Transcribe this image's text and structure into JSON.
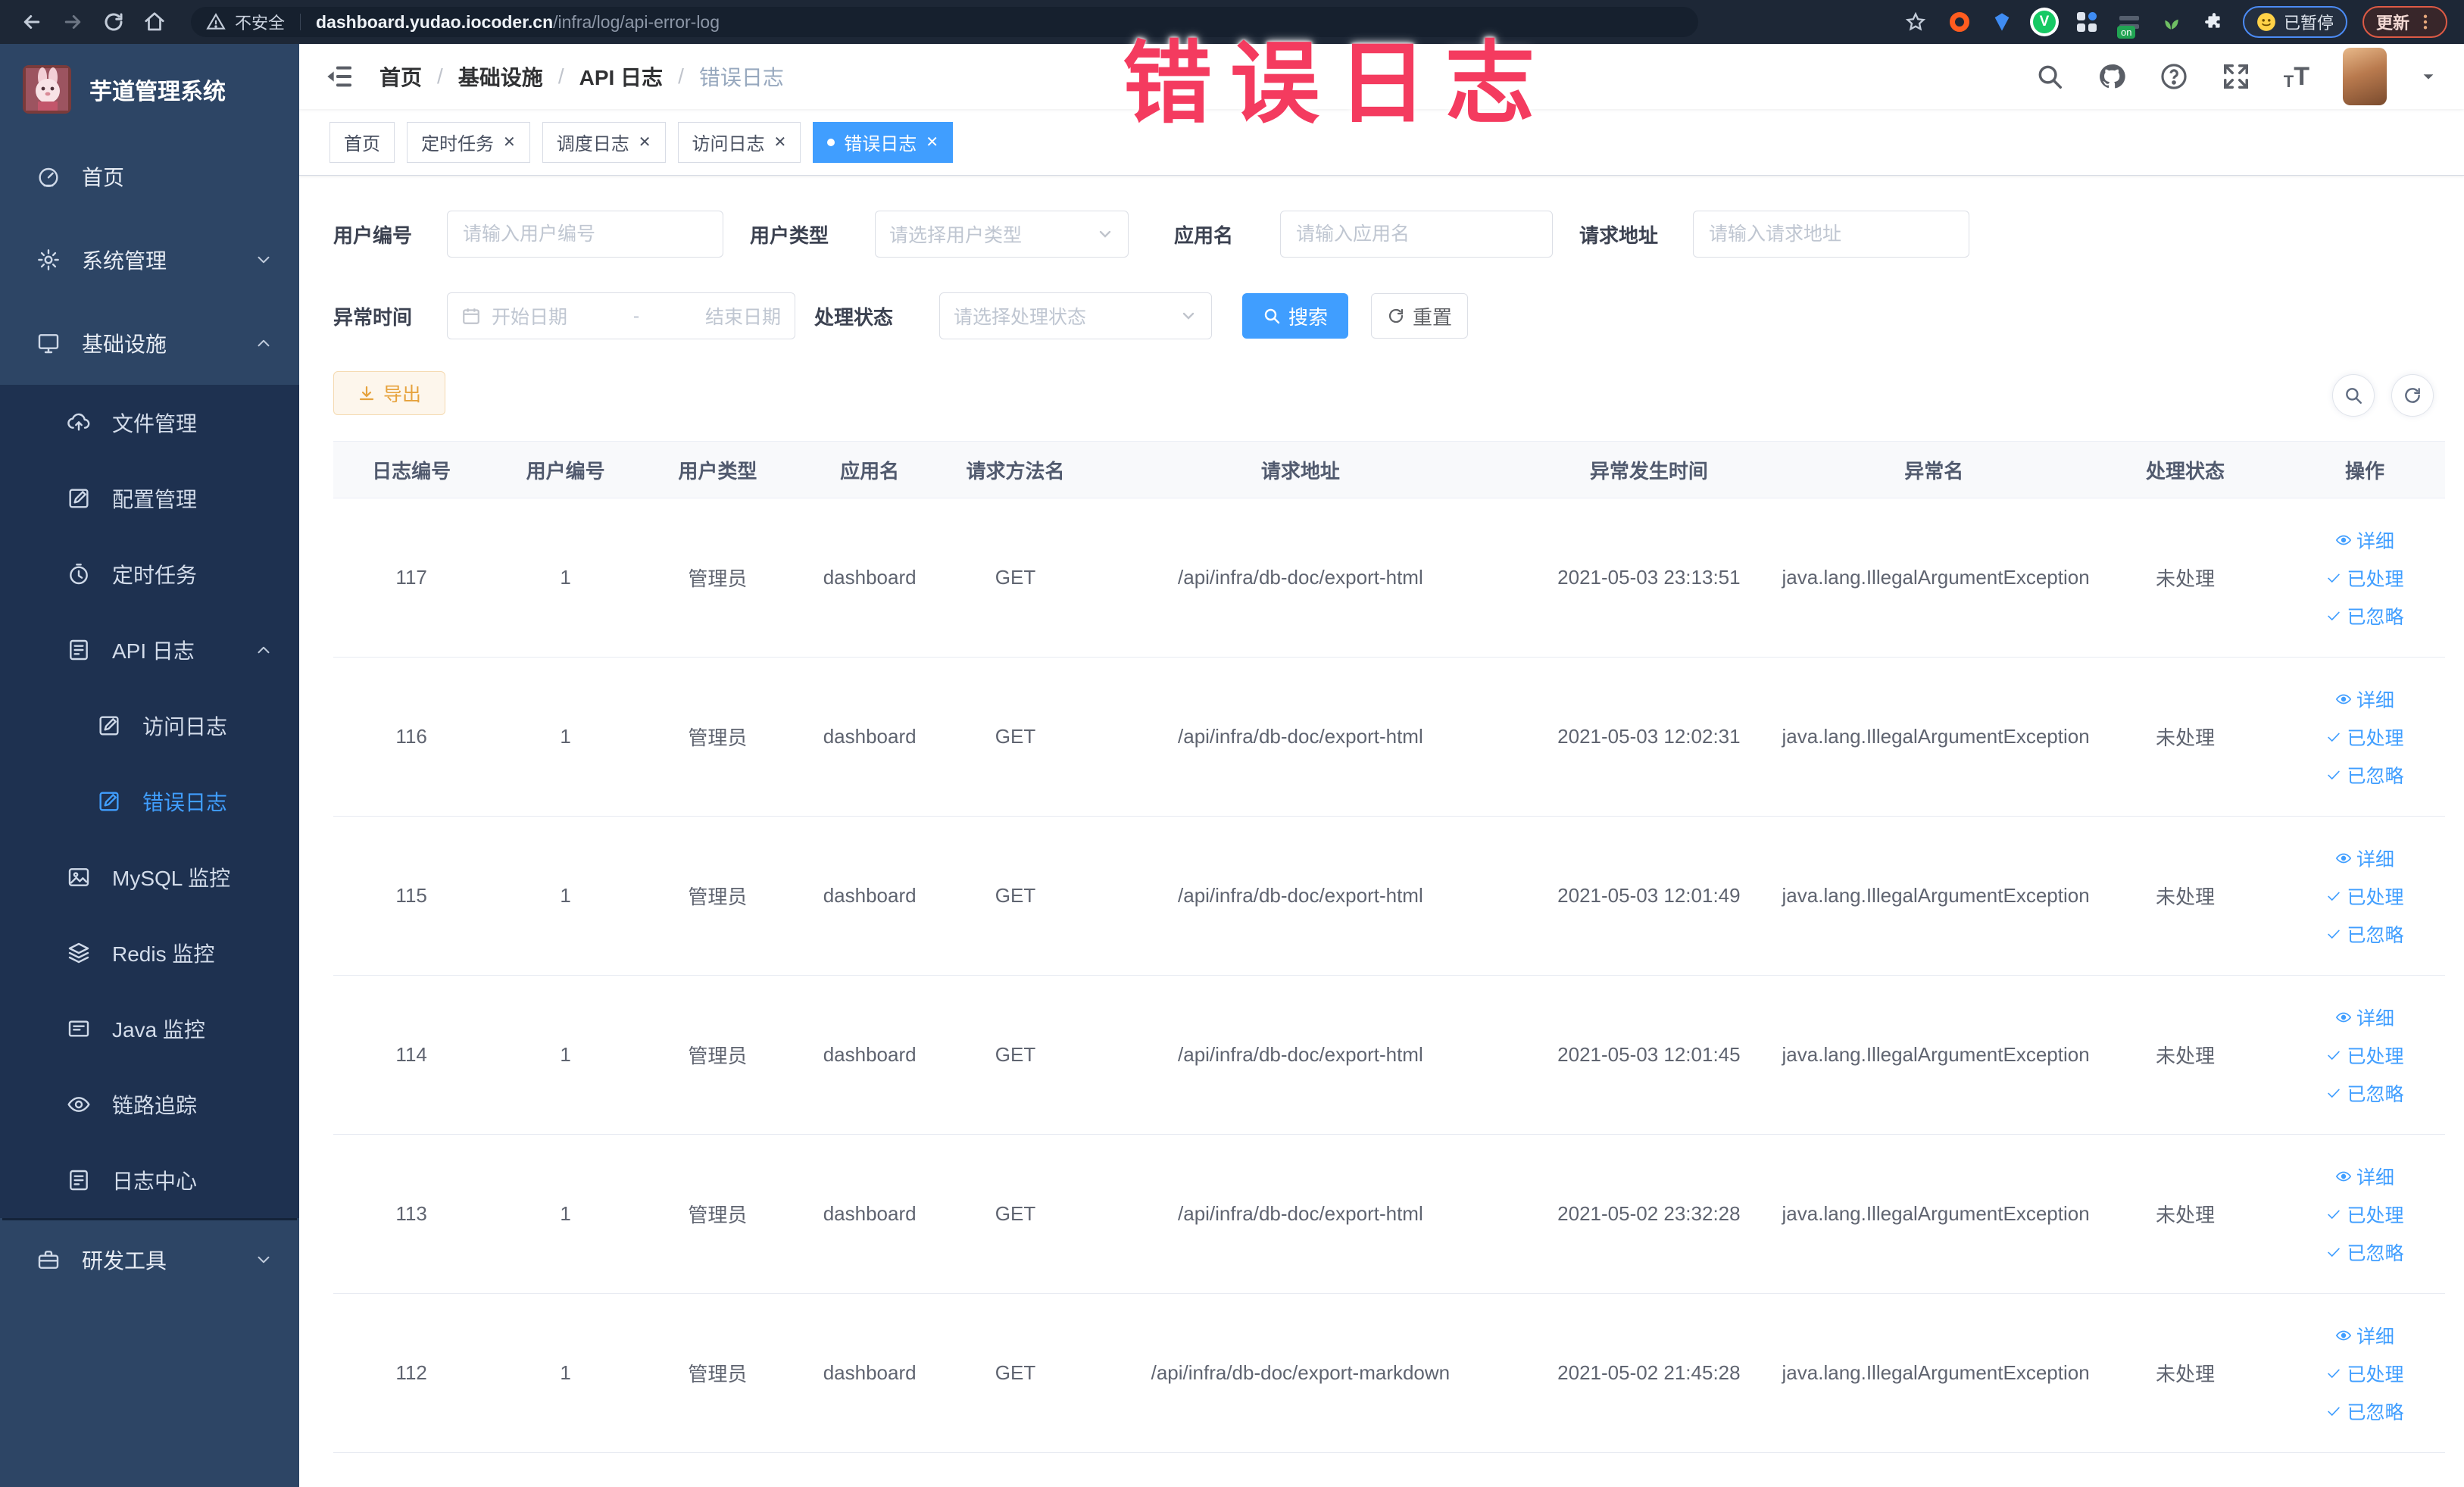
{
  "browser": {
    "security_label": "不安全",
    "url_domain": "dashboard.yudao.iocoder.cn",
    "url_path": "/infra/log/api-error-log",
    "paused_badge": "已暂停",
    "update_badge": "更新",
    "extension_on_badge": "on"
  },
  "overlay": {
    "title": "错误日志"
  },
  "sidebar": {
    "app_title": "芋道管理系统",
    "menu": [
      {
        "label": "首页",
        "icon": "gauge",
        "level": 0
      },
      {
        "label": "系统管理",
        "icon": "gear",
        "level": 0,
        "arrow": "down"
      },
      {
        "label": "基础设施",
        "icon": "monitor",
        "level": 0,
        "arrow": "up"
      },
      {
        "label": "文件管理",
        "icon": "upload",
        "level": 1
      },
      {
        "label": "配置管理",
        "icon": "edit",
        "level": 1
      },
      {
        "label": "定时任务",
        "icon": "timer",
        "level": 1
      },
      {
        "label": "API 日志",
        "icon": "log",
        "level": 1,
        "arrow": "up"
      },
      {
        "label": "访问日志",
        "icon": "edit",
        "level": 2
      },
      {
        "label": "错误日志",
        "icon": "edit",
        "level": 2,
        "active": true
      },
      {
        "label": "MySQL 监控",
        "icon": "chart",
        "level": 1
      },
      {
        "label": "Redis 监控",
        "icon": "layers",
        "level": 1
      },
      {
        "label": "Java 监控",
        "icon": "screen",
        "level": 1
      },
      {
        "label": "链路追踪",
        "icon": "eye",
        "level": 1
      },
      {
        "label": "日志中心",
        "icon": "log",
        "level": 1,
        "sublast": true
      },
      {
        "label": "研发工具",
        "icon": "toolbox",
        "level": 0,
        "arrow": "down"
      }
    ]
  },
  "breadcrumb": [
    "首页",
    "基础设施",
    "API 日志",
    "错误日志"
  ],
  "tabs": [
    {
      "label": "首页",
      "closable": false,
      "active": false
    },
    {
      "label": "定时任务",
      "closable": true,
      "active": false
    },
    {
      "label": "调度日志",
      "closable": true,
      "active": false
    },
    {
      "label": "访问日志",
      "closable": true,
      "active": false
    },
    {
      "label": "错误日志",
      "closable": true,
      "active": true
    }
  ],
  "filters": {
    "user_id": {
      "label": "用户编号",
      "placeholder": "请输入用户编号"
    },
    "user_type": {
      "label": "用户类型",
      "placeholder": "请选择用户类型"
    },
    "app_name": {
      "label": "应用名",
      "placeholder": "请输入应用名"
    },
    "request_url": {
      "label": "请求地址",
      "placeholder": "请输入请求地址"
    },
    "exception_time": {
      "label": "异常时间",
      "start_placeholder": "开始日期",
      "separator": "-",
      "end_placeholder": "结束日期"
    },
    "process_status": {
      "label": "处理状态",
      "placeholder": "请选择处理状态"
    },
    "search_button": "搜索",
    "reset_button": "重置"
  },
  "toolbar": {
    "export_button": "导出"
  },
  "table": {
    "headers": [
      "日志编号",
      "用户编号",
      "用户类型",
      "应用名",
      "请求方法名",
      "请求地址",
      "异常发生时间",
      "异常名",
      "处理状态",
      "操作"
    ],
    "actions": [
      "详细",
      "已处理",
      "已忽略"
    ],
    "rows": [
      {
        "id": "117",
        "user_id": "1",
        "user_type": "管理员",
        "app": "dashboard",
        "method": "GET",
        "url": "/api/infra/db-doc/export-html",
        "time": "2021-05-03 23:13:51",
        "exception": "java.lang.IllegalArgumentException",
        "status": "未处理"
      },
      {
        "id": "116",
        "user_id": "1",
        "user_type": "管理员",
        "app": "dashboard",
        "method": "GET",
        "url": "/api/infra/db-doc/export-html",
        "time": "2021-05-03 12:02:31",
        "exception": "java.lang.IllegalArgumentException",
        "status": "未处理"
      },
      {
        "id": "115",
        "user_id": "1",
        "user_type": "管理员",
        "app": "dashboard",
        "method": "GET",
        "url": "/api/infra/db-doc/export-html",
        "time": "2021-05-03 12:01:49",
        "exception": "java.lang.IllegalArgumentException",
        "status": "未处理"
      },
      {
        "id": "114",
        "user_id": "1",
        "user_type": "管理员",
        "app": "dashboard",
        "method": "GET",
        "url": "/api/infra/db-doc/export-html",
        "time": "2021-05-03 12:01:45",
        "exception": "java.lang.IllegalArgumentException",
        "status": "未处理"
      },
      {
        "id": "113",
        "user_id": "1",
        "user_type": "管理员",
        "app": "dashboard",
        "method": "GET",
        "url": "/api/infra/db-doc/export-html",
        "time": "2021-05-02 23:32:28",
        "exception": "java.lang.IllegalArgumentException",
        "status": "未处理"
      },
      {
        "id": "112",
        "user_id": "1",
        "user_type": "管理员",
        "app": "dashboard",
        "method": "GET",
        "url": "/api/infra/db-doc/export-markdown",
        "time": "2021-05-02 21:45:28",
        "exception": "java.lang.IllegalArgumentException",
        "status": "未处理"
      }
    ]
  }
}
